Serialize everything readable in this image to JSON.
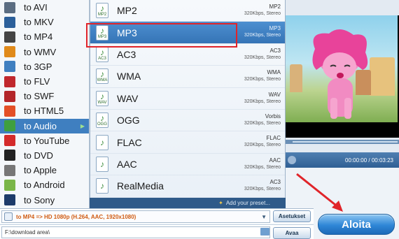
{
  "left_menu": {
    "items": [
      {
        "label": "to AVI",
        "icon": "film-icon",
        "color": "#5b6d82"
      },
      {
        "label": "to MKV",
        "icon": "mkv-icon",
        "color": "#2b5f9a"
      },
      {
        "label": "to MP4",
        "icon": "mp4-icon",
        "color": "#444444"
      },
      {
        "label": "to WMV",
        "icon": "wmv-icon",
        "color": "#e08a1a"
      },
      {
        "label": "to 3GP",
        "icon": "3gp-icon",
        "color": "#3f7fc0"
      },
      {
        "label": "to FLV",
        "icon": "flv-icon",
        "color": "#c0282d"
      },
      {
        "label": "to SWF",
        "icon": "swf-icon",
        "color": "#b3262a"
      },
      {
        "label": "to HTML5",
        "icon": "html5-icon",
        "color": "#e34f26"
      },
      {
        "label": "to Audio",
        "icon": "music-note-icon",
        "color": "#3f9f3f"
      },
      {
        "label": "to YouTube",
        "icon": "youtube-icon",
        "color": "#d42b2b"
      },
      {
        "label": "to DVD",
        "icon": "dvd-icon",
        "color": "#222222"
      },
      {
        "label": "to Apple",
        "icon": "apple-icon",
        "color": "#777777"
      },
      {
        "label": "to Android",
        "icon": "android-icon",
        "color": "#7ab648"
      },
      {
        "label": "to Sony",
        "icon": "playstation-icon",
        "color": "#1d3b6a"
      }
    ],
    "active_index": 8
  },
  "audio_menu": {
    "items": [
      {
        "name": "MP2",
        "format": "MP2",
        "rate": "320Kbps, Stereo",
        "tag": "MP2"
      },
      {
        "name": "MP3",
        "format": "MP3",
        "rate": "320Kbps, Stereo",
        "tag": "MP3"
      },
      {
        "name": "AC3",
        "format": "AC3",
        "rate": "320Kbps, Stereo",
        "tag": "AC3"
      },
      {
        "name": "WMA",
        "format": "WMA",
        "rate": "320Kbps, Stereo",
        "tag": "WMA"
      },
      {
        "name": "WAV",
        "format": "WAV",
        "rate": "320Kbps, Stereo",
        "tag": "WAV"
      },
      {
        "name": "OGG",
        "format": "Vorbis",
        "rate": "320Kbps, Stereo",
        "tag": "OGG"
      },
      {
        "name": "FLAC",
        "format": "FLAC",
        "rate": "320Kbps, Stereo",
        "tag": ""
      },
      {
        "name": "AAC",
        "format": "AAC",
        "rate": "320Kbps, Stereo",
        "tag": ""
      },
      {
        "name": "RealMedia",
        "format": "AC3",
        "rate": "320Kbps, Stereo",
        "tag": ""
      }
    ],
    "selected_index": 1,
    "add_preset": "Add your preset..."
  },
  "player": {
    "time": "00:00:00 / 00:03:23"
  },
  "bottom": {
    "profile": "to MP4 => HD 1080p (H.264, AAC, 1920x1080)",
    "settings_button": "Asetukset",
    "path": "F:\\download area\\",
    "open_button": "Avaa",
    "start_button": "Aloita"
  }
}
